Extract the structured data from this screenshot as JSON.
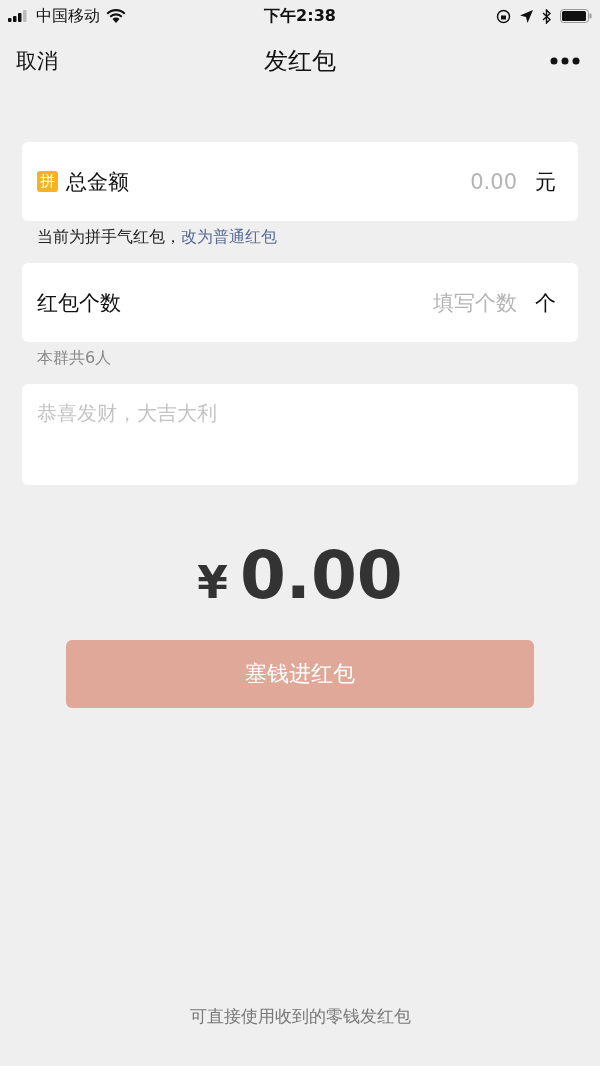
{
  "status_bar": {
    "carrier": "中国移动",
    "time": "下午2:38"
  },
  "nav": {
    "cancel": "取消",
    "title": "发红包"
  },
  "amount": {
    "badge": "拼",
    "label": "总金额",
    "placeholder": "0.00",
    "unit": "元"
  },
  "amount_note": {
    "text": "当前为拼手气红包，",
    "link": "改为普通红包"
  },
  "count": {
    "label": "红包个数",
    "placeholder": "填写个数",
    "unit": "个"
  },
  "count_note": "本群共6人",
  "message": {
    "placeholder": "恭喜发财，大吉大利"
  },
  "total": {
    "currency": "¥",
    "value": "0.00"
  },
  "submit": {
    "label": "塞钱进红包",
    "disabled": true
  },
  "footer": "可直接使用收到的零钱发红包"
}
